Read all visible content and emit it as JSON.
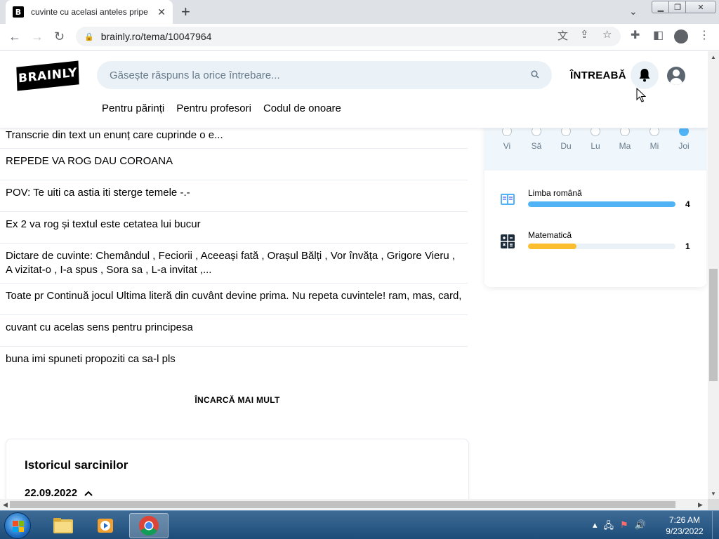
{
  "browser": {
    "tab_title": "cuvinte cu acelasi anteles pripe",
    "tab_favicon": "B",
    "url": "brainly.ro/tema/10047964"
  },
  "site": {
    "logo_text": "BRAINLY",
    "search_placeholder": "Găsește răspuns la orice întrebare...",
    "ask_label": "ÎNTREABĂ",
    "subnav": [
      "Pentru părinți",
      "Pentru profesori",
      "Codul de onoare"
    ]
  },
  "questions": [
    "Transcrie din text un enunț care cuprinde o e...",
    "REPEDE VA ROG DAU COROANA",
    "POV: Te uiti ca astia iti sterge temele -.-",
    "Ex 2 va rog și textul este cetatea lui bucur",
    "Dictare de cuvinte: Chemândul , Feciorii , Aceeași fată , Orașul Bălți , Vor învăța , Grigore Vieru , A vizitat-o , I-a spus , Sora sa , L-a invitat ,...",
    "Toate pr Continuă jocul Ultima literă din cuvânt devine prima. Nu repeta cuvintele! ram, mas, card,",
    "cuvant cu acelas sens pentru principesa",
    "buna imi spuneti propoziti ca sa-l pls"
  ],
  "load_more_label": "ÎNCARCĂ MAI MULT",
  "history": {
    "title": "Istoricul sarcinilor",
    "date": "22.09.2022"
  },
  "streak": {
    "days": [
      "Vi",
      "Să",
      "Du",
      "Lu",
      "Ma",
      "Mi",
      "Joi"
    ],
    "active_index": 6
  },
  "subjects": [
    {
      "name": "Limba română",
      "count": "4",
      "progress": 1.0,
      "color": "#4fb3f6"
    },
    {
      "name": "Matematică",
      "count": "1",
      "progress": 0.33,
      "color": "#fbbe2e"
    }
  ],
  "taskbar": {
    "time": "7:26 AM",
    "date": "9/23/2022"
  },
  "colors": {
    "accent_blue": "#4fb3f6",
    "accent_yellow": "#fbbe2e",
    "search_bg": "#ebf2f7"
  }
}
